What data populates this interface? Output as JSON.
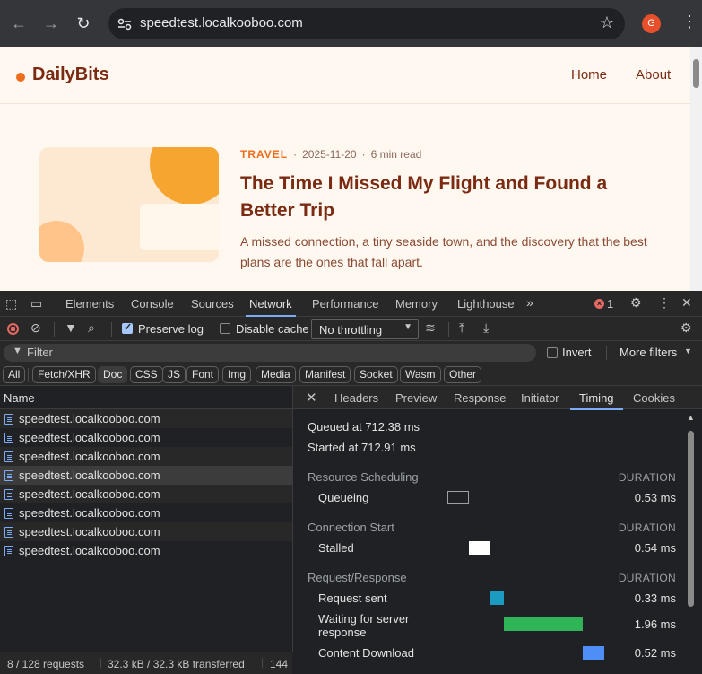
{
  "browser": {
    "url": "speedtest.localkooboo.com",
    "profile_initial": "G"
  },
  "site": {
    "logo": "DailyBits",
    "nav": [
      "Home",
      "About"
    ],
    "article": {
      "category": "TRAVEL",
      "date": "2025-11-20",
      "read_time": "6 min read",
      "title": "The Time I Missed My Flight and Found a Better Trip",
      "excerpt": "A missed connection, a tiny seaside town, and the discovery that the best plans are the ones that fall apart."
    }
  },
  "devtools": {
    "tabs": [
      "Elements",
      "Console",
      "Sources",
      "Network",
      "Performance",
      "Memory",
      "Lighthouse"
    ],
    "active_tab": "Network",
    "error_count": "1",
    "toolbar": {
      "preserve_log": "Preserve log",
      "disable_cache": "Disable cache",
      "throttling": "No throttling"
    },
    "filter": {
      "placeholder": "Filter",
      "invert": "Invert",
      "more_filters": "More filters"
    },
    "types": [
      "All",
      "Fetch/XHR",
      "Doc",
      "CSS",
      "JS",
      "Font",
      "Img",
      "Media",
      "Manifest",
      "Socket",
      "Wasm",
      "Other"
    ],
    "active_type": "Doc",
    "requests": {
      "header": "Name",
      "rows": [
        "speedtest.localkooboo.com",
        "speedtest.localkooboo.com",
        "speedtest.localkooboo.com",
        "speedtest.localkooboo.com",
        "speedtest.localkooboo.com",
        "speedtest.localkooboo.com",
        "speedtest.localkooboo.com",
        "speedtest.localkooboo.com"
      ]
    },
    "status": {
      "requests": "8 / 128 requests",
      "transferred": "32.3 kB / 32.3 kB transferred",
      "extra": "144"
    },
    "detail_tabs": [
      "Headers",
      "Preview",
      "Response",
      "Initiator",
      "Timing",
      "Cookies"
    ],
    "active_detail_tab": "Timing",
    "timing": {
      "queued": "Queued at 712.38 ms",
      "started": "Started at 712.91 ms",
      "duration_label": "DURATION",
      "sections": [
        {
          "title": "Resource Scheduling",
          "phases": [
            {
              "name": "Queueing",
              "value": "0.53 ms",
              "color": "#202124",
              "border": "#9aa0a6",
              "start": 0,
              "dur": 0.53
            }
          ]
        },
        {
          "title": "Connection Start",
          "phases": [
            {
              "name": "Stalled",
              "value": "0.54 ms",
              "color": "#ffffff",
              "border": "#ffffff",
              "start": 0.53,
              "dur": 0.54
            }
          ]
        },
        {
          "title": "Request/Response",
          "phases": [
            {
              "name": "Request sent",
              "value": "0.33 ms",
              "color": "#1a9bbf",
              "border": "#1a9bbf",
              "start": 1.07,
              "dur": 0.33
            },
            {
              "name": "Waiting for server response",
              "value": "1.96 ms",
              "color": "#2fb457",
              "border": "#2fb457",
              "start": 1.4,
              "dur": 1.96
            },
            {
              "name": "Content Download",
              "value": "0.52 ms",
              "color": "#4e8ef7",
              "border": "#4e8ef7",
              "start": 3.36,
              "dur": 0.52
            }
          ]
        }
      ]
    }
  }
}
